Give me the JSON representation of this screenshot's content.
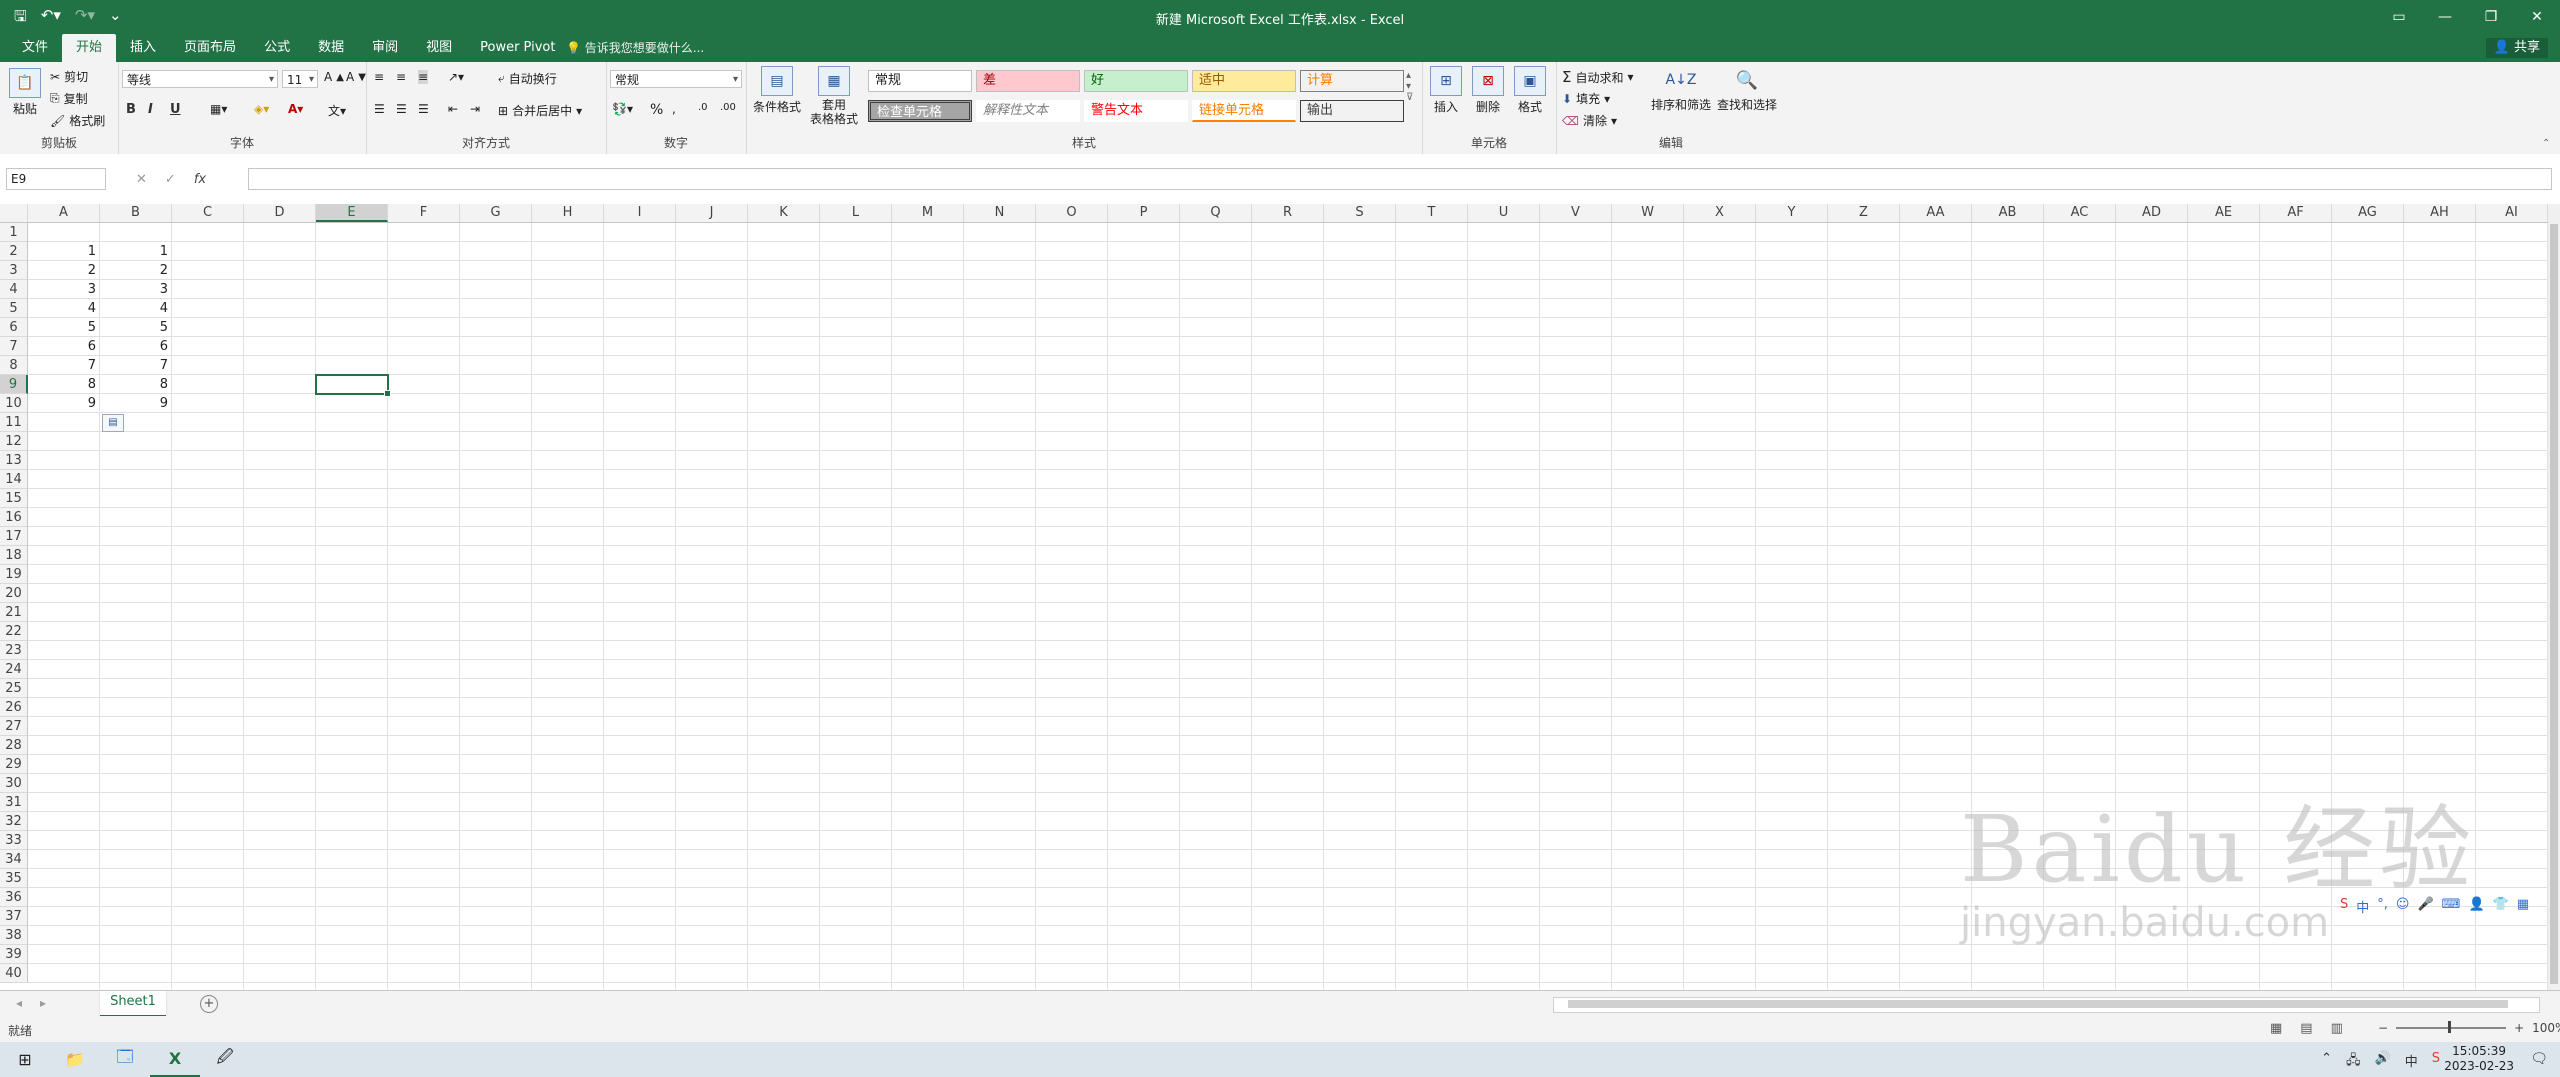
{
  "window": {
    "title": "新建 Microsoft Excel 工作表.xlsx - Excel",
    "qat": [
      "save-icon",
      "undo-icon",
      "redo-icon",
      "customize-icon"
    ]
  },
  "ribbon_tabs": [
    "文件",
    "开始",
    "插入",
    "页面布局",
    "公式",
    "数据",
    "审阅",
    "视图",
    "Power Pivot"
  ],
  "active_tab": "开始",
  "tell_me": "告诉我您想要做什么...",
  "share": "共享",
  "ribbon": {
    "clipboard": {
      "paste": "粘贴",
      "cut": "剪切",
      "copy": "复制",
      "format_painter": "格式刷",
      "label": "剪贴板"
    },
    "font": {
      "family": "等线",
      "size": "11",
      "bold": "B",
      "italic": "I",
      "underline": "U",
      "label": "字体"
    },
    "alignment": {
      "wrap": "自动换行",
      "merge": "合并后居中",
      "label": "对齐方式"
    },
    "number": {
      "format": "常规",
      "percent": "%",
      "label": "数字"
    },
    "styles": {
      "conditional": "条件格式",
      "table_line1": "套用",
      "table_line2": "表格格式",
      "cells": [
        {
          "text": "常规"
        },
        {
          "text": "差"
        },
        {
          "text": "好"
        },
        {
          "text": "适中"
        },
        {
          "text": "计算"
        },
        {
          "text": "检查单元格"
        },
        {
          "text": "解释性文本"
        },
        {
          "text": "警告文本"
        },
        {
          "text": "链接单元格"
        },
        {
          "text": "输出"
        }
      ],
      "label": "样式"
    },
    "cells": {
      "insert": "插入",
      "delete": "删除",
      "format": "格式",
      "label": "单元格"
    },
    "editing": {
      "autosum": "自动求和",
      "fill": "填充",
      "clear": "清除",
      "sort": "排序和筛选",
      "find": "查找和选择",
      "label": "编辑"
    }
  },
  "formula_bar": {
    "name_box": "E9",
    "fx": "fx",
    "cancel": "✕",
    "enter": "✓",
    "content": ""
  },
  "columns": [
    "A",
    "B",
    "C",
    "D",
    "E",
    "F",
    "G",
    "H",
    "I",
    "J",
    "K",
    "L",
    "M",
    "N",
    "O",
    "P",
    "Q",
    "R",
    "S",
    "T",
    "U",
    "V",
    "W",
    "X",
    "Y",
    "Z",
    "AA",
    "AB",
    "AC",
    "AD",
    "AE",
    "AF",
    "AG",
    "AH",
    "AI"
  ],
  "selected_col": "E",
  "rows": [
    "1",
    "2",
    "3",
    "4",
    "5",
    "6",
    "7",
    "8",
    "9",
    "10",
    "11",
    "12",
    "13",
    "14",
    "15",
    "16",
    "17",
    "18",
    "19",
    "20",
    "21",
    "22",
    "23",
    "24",
    "25",
    "26",
    "27",
    "28",
    "29",
    "30",
    "31",
    "32",
    "33",
    "34",
    "35",
    "36",
    "37",
    "38",
    "39",
    "40"
  ],
  "selected_row": "9",
  "cell_values": {
    "A": [
      "1",
      "2",
      "3",
      "4",
      "5",
      "6",
      "7",
      "8",
      "9"
    ],
    "B": [
      "1",
      "2",
      "3",
      "4",
      "5",
      "6",
      "7",
      "8",
      "9"
    ]
  },
  "sheets": [
    "Sheet1"
  ],
  "status": {
    "ready": "就绪",
    "zoom": "100%"
  },
  "taskbar": {
    "time": "15:05:39",
    "date": "2023-02-23"
  },
  "watermark": {
    "brand": "Baidu 经验",
    "url": "jingyan.baidu.com"
  }
}
